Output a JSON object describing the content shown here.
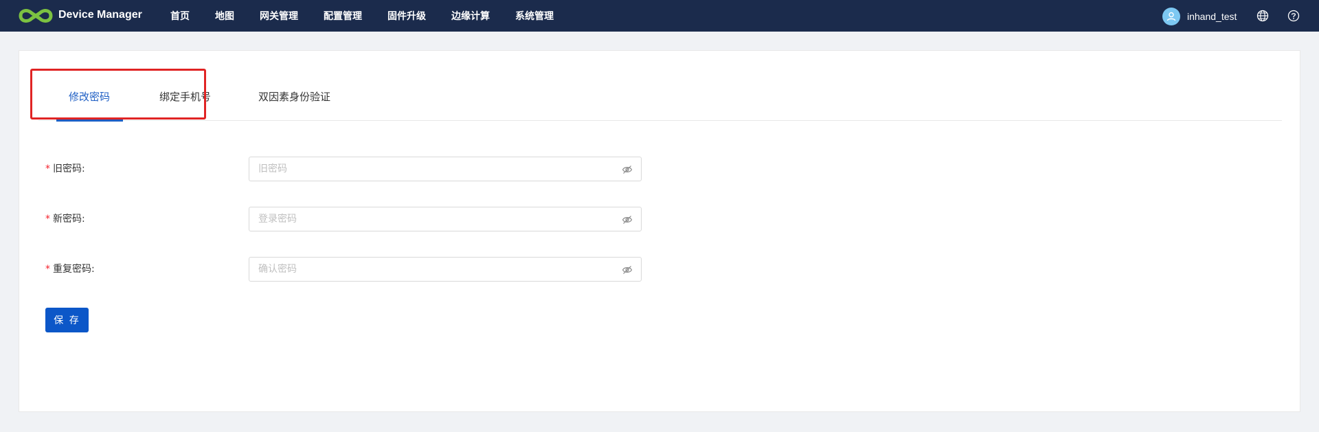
{
  "header": {
    "brand": "Device Manager",
    "nav": [
      {
        "label": "首页"
      },
      {
        "label": "地图"
      },
      {
        "label": "网关管理"
      },
      {
        "label": "配置管理"
      },
      {
        "label": "固件升级"
      },
      {
        "label": "边缘计算"
      },
      {
        "label": "系统管理"
      }
    ],
    "username": "inhand_test",
    "icons": {
      "avatar": "user-icon",
      "language": "globe-icon",
      "help": "question-icon"
    },
    "background": "#1b2b4c",
    "logo_color": "#7cc241"
  },
  "tabs": [
    {
      "label": "修改密码",
      "active": true
    },
    {
      "label": "绑定手机号",
      "active": false
    },
    {
      "label": "双因素身份验证",
      "active": false
    }
  ],
  "form": {
    "required_mark": "*",
    "fields": [
      {
        "label": "旧密码:",
        "placeholder": "旧密码",
        "value": ""
      },
      {
        "label": "新密码:",
        "placeholder": "登录密码",
        "value": ""
      },
      {
        "label": "重复密码:",
        "placeholder": "确认密码",
        "value": ""
      }
    ],
    "save_label": "保 存"
  },
  "colors": {
    "accent": "#1f5fc4",
    "button": "#0c57c8",
    "highlight": "#e02424",
    "required": "#f5222d"
  }
}
